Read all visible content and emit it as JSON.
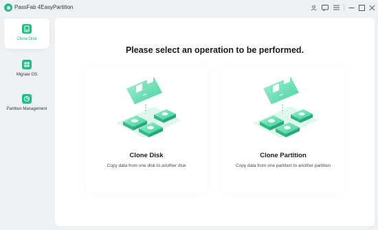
{
  "app": {
    "title": "PassFab 4EasyPartition"
  },
  "titlebar_icons": [
    "user-icon",
    "feedback-icon",
    "menu-icon",
    "minimize-icon",
    "maximize-icon",
    "close-icon"
  ],
  "sidebar": {
    "items": [
      {
        "label": "Clone Disk",
        "icon": "clone-disk-icon",
        "active": true
      },
      {
        "label": "Migrate OS",
        "icon": "migrate-os-icon",
        "active": false
      },
      {
        "label": "Partition Management",
        "icon": "partition-management-icon",
        "active": false
      }
    ]
  },
  "main": {
    "heading": "Please select an operation to be performed.",
    "cards": [
      {
        "title": "Clone Disk",
        "description": "Copy data from one disk to another disk"
      },
      {
        "title": "Clone Partition",
        "description": "Copy data from one partition to another partition"
      }
    ]
  },
  "colors": {
    "accent": "#1fbf86",
    "active_text": "#1aa874",
    "background": "#eef1f4"
  }
}
